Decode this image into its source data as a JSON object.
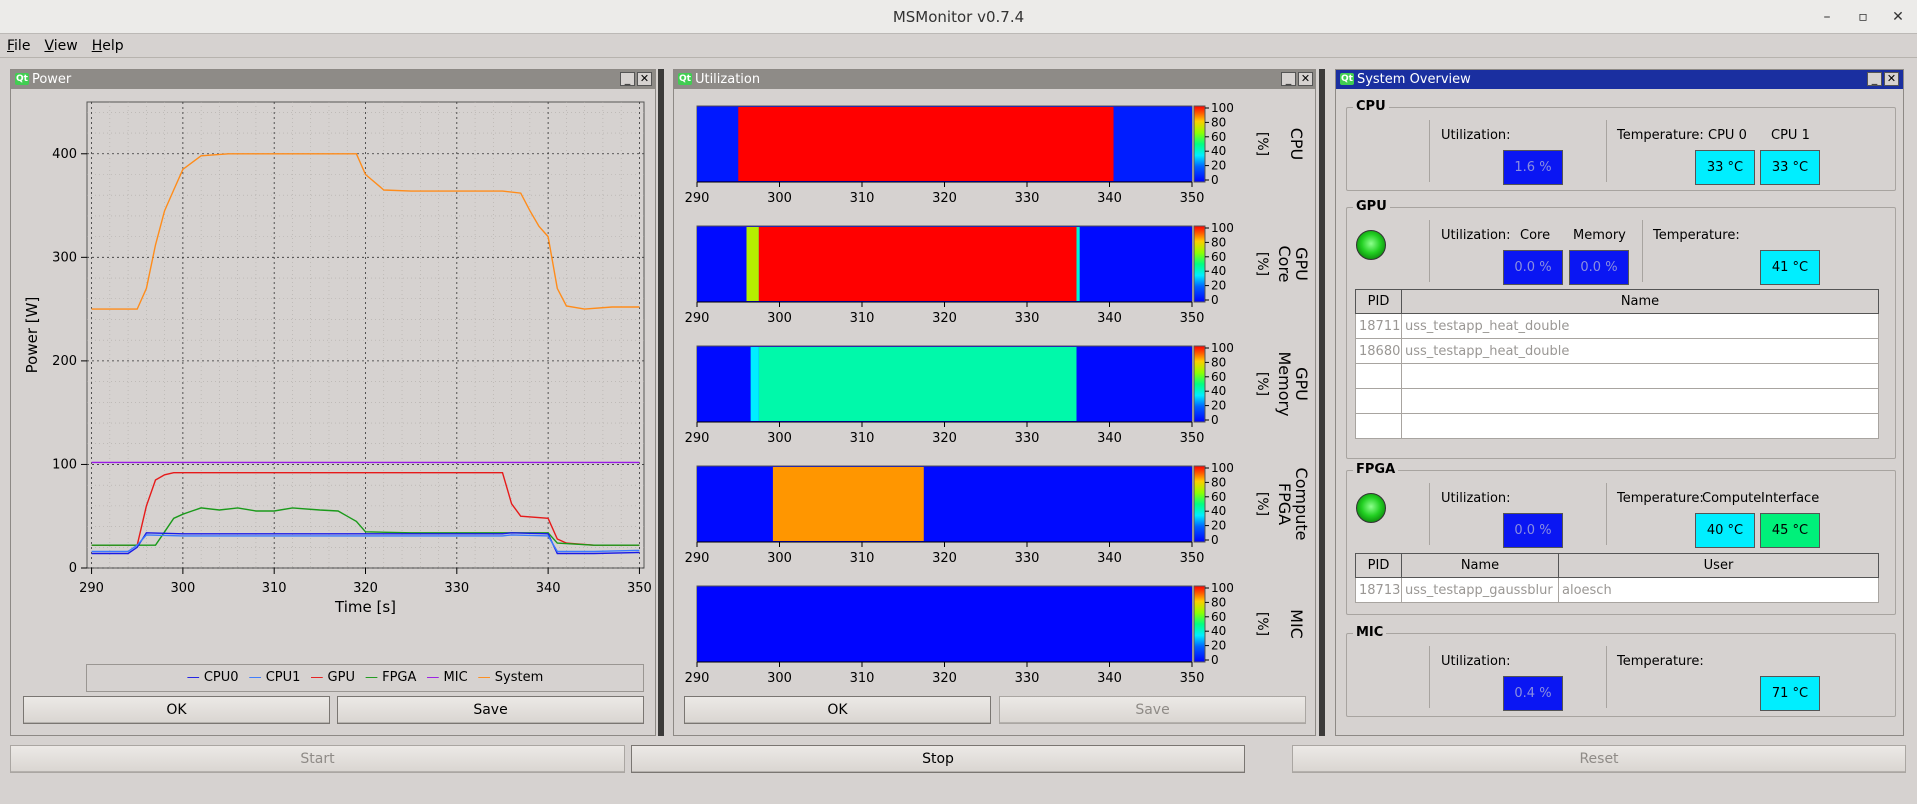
{
  "window": {
    "title": "MSMonitor v0.7.4",
    "min": "–",
    "max": "▫",
    "close": "✕"
  },
  "menu": [
    "File",
    "View",
    "Help"
  ],
  "power_dock": {
    "title": "Power",
    "ok_label": "OK",
    "save_label": "Save",
    "legend": [
      {
        "name": "CPU0",
        "color": "#1a1ae6"
      },
      {
        "name": "CPU1",
        "color": "#3a7aff"
      },
      {
        "name": "GPU",
        "color": "#e61a1a"
      },
      {
        "name": "FPGA",
        "color": "#1a9a1a"
      },
      {
        "name": "MIC",
        "color": "#9a1ae6"
      },
      {
        "name": "System",
        "color": "#ff8c1a"
      }
    ]
  },
  "utilization_dock": {
    "title": "Utilization",
    "ok_label": "OK",
    "save_label": "Save",
    "colorbar_ticks": [
      "100",
      "80",
      "60",
      "40",
      "20",
      "0"
    ],
    "unit": "[%]",
    "x_ticks": [
      "290",
      "300",
      "310",
      "320",
      "330",
      "340",
      "350"
    ],
    "heatmaps": [
      {
        "label_lines": [
          "CPU"
        ]
      },
      {
        "label_lines": [
          "GPU",
          "Core"
        ]
      },
      {
        "label_lines": [
          "GPU",
          "Memory"
        ]
      },
      {
        "label_lines": [
          "Compute",
          "FPGA"
        ]
      },
      {
        "label_lines": [
          "MIC"
        ]
      }
    ]
  },
  "overview_dock": {
    "title": "System Overview",
    "cpu": {
      "title": "CPU",
      "util_label": "Utilization:",
      "util_value": "1.6 %",
      "temp_label": "Temperature:",
      "cpu0_label": "CPU 0",
      "cpu1_label": "CPU 1",
      "cpu0_temp": "33 °C",
      "cpu1_temp": "33 °C"
    },
    "gpu": {
      "title": "GPU",
      "util_label": "Utilization:",
      "core_label": "Core",
      "memory_label": "Memory",
      "core_value": "0.0 %",
      "memory_value": "0.0 %",
      "temp_label": "Temperature:",
      "temp_value": "41 °C",
      "table_headers": [
        "PID",
        "Name"
      ],
      "rows": [
        {
          "pid": "18711",
          "name": "uss_testapp_heat_double"
        },
        {
          "pid": "18680",
          "name": "uss_testapp_heat_double"
        },
        {
          "pid": "",
          "name": ""
        },
        {
          "pid": "",
          "name": ""
        },
        {
          "pid": "",
          "name": ""
        }
      ]
    },
    "fpga": {
      "title": "FPGA",
      "util_label": "Utilization:",
      "util_value": "0.0 %",
      "temp_label": "Temperature:",
      "compute_label": "Compute",
      "interface_label": "Interface",
      "compute_temp": "40 °C",
      "interface_temp": "45 °C",
      "table_headers": [
        "PID",
        "Name",
        "User"
      ],
      "rows": [
        {
          "pid": "18713",
          "name": "uss_testapp_gaussblur",
          "user": "aloesch"
        }
      ]
    },
    "mic": {
      "title": "MIC",
      "util_label": "Utilization:",
      "util_value": "0.4 %",
      "temp_label": "Temperature:",
      "temp_value": "71 °C"
    }
  },
  "bottom": {
    "start_label": "Start",
    "stop_label": "Stop",
    "reset_label": "Reset"
  },
  "chart_data": [
    {
      "type": "line",
      "title": "",
      "xlabel": "Time [s]",
      "ylabel": "Power [W]",
      "xlim": [
        289.5,
        350.5
      ],
      "ylim": [
        0,
        450
      ],
      "x_ticks": [
        290,
        300,
        310,
        320,
        330,
        340,
        350
      ],
      "y_ticks": [
        0,
        100,
        200,
        300,
        400
      ],
      "grid": true,
      "legend": "bottom",
      "series": [
        {
          "name": "System",
          "x": [
            290,
            295,
            296,
            297,
            298,
            299,
            300,
            302,
            305,
            310,
            315,
            319,
            320,
            322,
            325,
            330,
            335,
            337,
            338,
            339,
            340,
            341,
            342,
            344,
            347,
            350
          ],
          "values": [
            250,
            250,
            270,
            312,
            345,
            365,
            385,
            398,
            400,
            400,
            400,
            400,
            380,
            365,
            364,
            364,
            364,
            362,
            345,
            330,
            320,
            270,
            253,
            250,
            252,
            252
          ]
        },
        {
          "name": "MIC",
          "x": [
            290,
            300,
            310,
            320,
            330,
            340,
            350
          ],
          "values": [
            102,
            102,
            102,
            102,
            102,
            102,
            102
          ]
        },
        {
          "name": "GPU",
          "x": [
            290,
            295,
            296,
            297,
            298,
            299,
            300,
            305,
            310,
            315,
            320,
            325,
            330,
            335,
            336,
            337,
            340,
            341,
            342,
            345,
            350
          ],
          "values": [
            22,
            22,
            60,
            85,
            90,
            92,
            92,
            92,
            92,
            92,
            92,
            92,
            92,
            92,
            62,
            50,
            48,
            28,
            24,
            22,
            22
          ]
        },
        {
          "name": "FPGA",
          "x": [
            290,
            297,
            298,
            299,
            300,
            301,
            302,
            304,
            306,
            308,
            310,
            312,
            315,
            317,
            318,
            319,
            320,
            325,
            330,
            335,
            340,
            341,
            345,
            350
          ],
          "values": [
            22,
            22,
            35,
            48,
            52,
            55,
            58,
            56,
            58,
            55,
            55,
            58,
            56,
            55,
            50,
            45,
            35,
            34,
            34,
            34,
            34,
            24,
            22,
            22
          ]
        },
        {
          "name": "CPU0",
          "x": [
            290,
            294,
            295,
            296,
            300,
            310,
            320,
            330,
            335,
            336,
            340,
            341,
            345,
            350
          ],
          "values": [
            14,
            14,
            20,
            34,
            33,
            33,
            33,
            33,
            33,
            34,
            33,
            14,
            14,
            15
          ]
        },
        {
          "name": "CPU1",
          "x": [
            290,
            294,
            295,
            296,
            300,
            310,
            320,
            330,
            335,
            336,
            340,
            341,
            345,
            350
          ],
          "values": [
            16,
            16,
            22,
            32,
            31,
            31,
            31,
            31,
            31,
            32,
            31,
            16,
            16,
            17
          ]
        }
      ]
    },
    {
      "type": "heatmap",
      "title": "CPU",
      "xlim": [
        290,
        350
      ],
      "zlim": [
        0,
        100
      ],
      "segments": [
        {
          "x0": 290,
          "x1": 295,
          "value": 5
        },
        {
          "x0": 295,
          "x1": 340.5,
          "value": 100
        },
        {
          "x0": 340.5,
          "x1": 350,
          "value": 6
        }
      ]
    },
    {
      "type": "heatmap",
      "title": "GPU Core",
      "xlim": [
        290,
        350
      ],
      "zlim": [
        0,
        100
      ],
      "segments": [
        {
          "x0": 290,
          "x1": 296,
          "value": 2
        },
        {
          "x0": 296,
          "x1": 297.5,
          "value": 70
        },
        {
          "x0": 297.5,
          "x1": 336,
          "value": 100
        },
        {
          "x0": 336,
          "x1": 336.4,
          "value": 40
        },
        {
          "x0": 336.4,
          "x1": 350,
          "value": 2
        }
      ]
    },
    {
      "type": "heatmap",
      "title": "GPU Memory",
      "xlim": [
        290,
        350
      ],
      "zlim": [
        0,
        100
      ],
      "segments": [
        {
          "x0": 290,
          "x1": 296.5,
          "value": 2
        },
        {
          "x0": 296.5,
          "x1": 297.5,
          "value": 35
        },
        {
          "x0": 297.5,
          "x1": 336,
          "value": 45
        },
        {
          "x0": 336,
          "x1": 350,
          "value": 2
        }
      ]
    },
    {
      "type": "heatmap",
      "title": "Compute FPGA",
      "xlim": [
        290,
        350
      ],
      "zlim": [
        0,
        100
      ],
      "segments": [
        {
          "x0": 290,
          "x1": 299.2,
          "value": 2
        },
        {
          "x0": 299.2,
          "x1": 317.5,
          "value": 85
        },
        {
          "x0": 317.5,
          "x1": 350,
          "value": 2
        }
      ]
    },
    {
      "type": "heatmap",
      "title": "MIC",
      "xlim": [
        290,
        350
      ],
      "zlim": [
        0,
        100
      ],
      "segments": [
        {
          "x0": 290,
          "x1": 350,
          "value": 1
        }
      ]
    }
  ]
}
